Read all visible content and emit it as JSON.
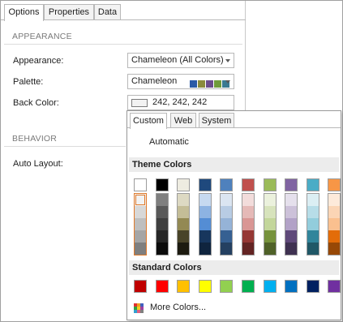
{
  "tabs": [
    "Options",
    "Properties",
    "Data"
  ],
  "appearance_section": {
    "title": "APPEARANCE",
    "fields": {
      "appearance": {
        "label": "Appearance:",
        "value": "Chameleon (All Colors)"
      },
      "palette": {
        "label": "Palette:",
        "value": "Chameleon",
        "preview_colors": [
          "#2b5aa6",
          "#8a8a3c",
          "#6b4c8c",
          "#6f9b3a",
          "#3a7a92"
        ]
      },
      "back_color": {
        "label": "Back Color:",
        "value": "242, 242, 242",
        "chip_color": "#f2f2f2"
      }
    }
  },
  "behavior_section": {
    "title": "BEHAVIOR",
    "fields": {
      "auto_layout": {
        "label": "Auto Layout:"
      }
    }
  },
  "color_popup": {
    "tabs": [
      "Custom",
      "Web",
      "System"
    ],
    "automatic_label": "Automatic",
    "theme_title": "Theme Colors",
    "theme_colors": [
      {
        "top": "#ffffff",
        "shades": [
          "#f2f2f2",
          "#d8d8d8",
          "#bfbfbf",
          "#a5a5a5",
          "#7f7f7f"
        ]
      },
      {
        "top": "#000000",
        "shades": [
          "#7f7f7f",
          "#595959",
          "#3f3f3f",
          "#262626",
          "#0c0c0c"
        ]
      },
      {
        "top": "#eeece1",
        "shades": [
          "#ddd9c3",
          "#c4bd97",
          "#938953",
          "#494429",
          "#1d1b10"
        ]
      },
      {
        "top": "#1f497d",
        "shades": [
          "#c6d9f0",
          "#8db3e2",
          "#548dd4",
          "#17365d",
          "#0f243e"
        ]
      },
      {
        "top": "#4f81bd",
        "shades": [
          "#dbe5f1",
          "#b8cce4",
          "#95b3d7",
          "#366092",
          "#244061"
        ]
      },
      {
        "top": "#c0504d",
        "shades": [
          "#f2dcdb",
          "#e5b9b7",
          "#d99694",
          "#953734",
          "#632423"
        ]
      },
      {
        "top": "#9bbb59",
        "shades": [
          "#ebf1dd",
          "#d7e3bc",
          "#c3d69b",
          "#76923c",
          "#4f6128"
        ]
      },
      {
        "top": "#8064a2",
        "shades": [
          "#e5e0ec",
          "#ccc1d9",
          "#b2a2c7",
          "#5f497a",
          "#3f3151"
        ]
      },
      {
        "top": "#4bacc6",
        "shades": [
          "#dbeef3",
          "#b7dde8",
          "#92cddc",
          "#31859b",
          "#205867"
        ]
      },
      {
        "top": "#f79646",
        "shades": [
          "#fdeada",
          "#fbd5b5",
          "#fac08f",
          "#e36c09",
          "#974806"
        ]
      }
    ],
    "selected_theme_column": 0,
    "standard_title": "Standard Colors",
    "standard_colors": [
      "#c00000",
      "#ff0000",
      "#ffc000",
      "#ffff00",
      "#92d050",
      "#00b050",
      "#00b0f0",
      "#0070c0",
      "#002060",
      "#7030a0"
    ],
    "more_label": "More Colors...",
    "more_icon_colors": [
      "#e03030",
      "#f0a020",
      "#4060c0",
      "#30a040",
      "#f0d020",
      "#a040a0",
      "#30a0d0",
      "#e06080",
      "#808080"
    ]
  }
}
